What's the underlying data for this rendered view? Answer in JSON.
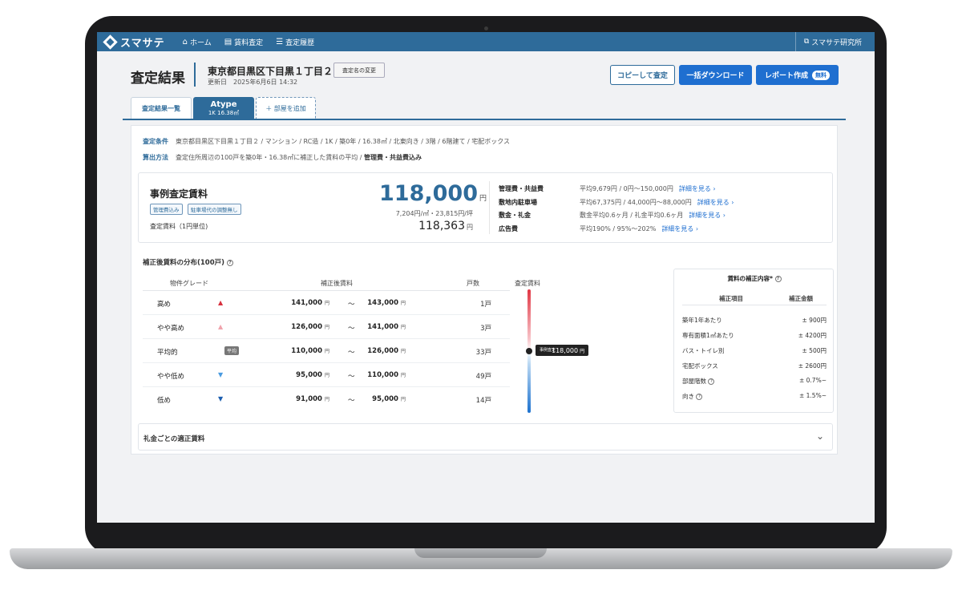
{
  "nav": {
    "logo": "スマサテ",
    "items": [
      {
        "icon": "home-icon",
        "label": "ホーム"
      },
      {
        "icon": "document-icon",
        "label": "賃料査定"
      },
      {
        "icon": "list-icon",
        "label": "査定履歴"
      }
    ],
    "right_icon": "external-link-icon",
    "right_label": "スマサテ研究所"
  },
  "header": {
    "title": "査定結果",
    "address": "東京都目黒区下目黒１丁目２",
    "updated": "更新日　2025年6月6日 14:32",
    "rename_button": "査定名の変更",
    "copy_button": "コピーして査定",
    "download_button": "一括ダウンロード",
    "report_button": "レポート作成",
    "free_badge": "無料"
  },
  "tabs": {
    "list": "査定結果一覧",
    "active_name": "Atype",
    "active_sub": "1K 16.38㎡",
    "add": "＋ 部屋を追加"
  },
  "conditions": {
    "label1": "査定条件",
    "value1": "東京都目黒区下目黒１丁目２ / マンション / RC造 / 1K / 築0年 / 16.38㎡ / 北東向き / 3階 / 6階建て / 宅配ボックス",
    "label2": "算出方法",
    "value2a": "査定住所周辺の100戸を築0年・16.38㎡に補正した賃料の平均 /",
    "value2b": "管理費・共益費込み"
  },
  "summary": {
    "title": "事例査定賃料",
    "tag1": "管理費込み",
    "tag2": "駐車場代の調整無し",
    "subtitle": "査定賃料（1円単位)",
    "price": "118,000",
    "yen": "円",
    "unit_price": "7,204円/㎡・23,815円/坪",
    "exact": "118,363",
    "fees": [
      {
        "key": "管理費・共益費",
        "value": "平均9,679円 / 0円〜150,000円",
        "link": "詳細を見る ›"
      },
      {
        "key": "敷地内駐車場",
        "value": "平均67,375円 / 44,000円〜88,000円",
        "link": "詳細を見る ›"
      },
      {
        "key": "敷金・礼金",
        "value": "敷金平均0.6ヶ月 / 礼金平均0.6ヶ月",
        "link": "詳細を見る ›"
      },
      {
        "key": "広告費",
        "value": "平均190% / 95%〜202%",
        "link": "詳細を見る ›"
      }
    ]
  },
  "distribution": {
    "title": "補正後賃料の分布(100戸)",
    "col_grade": "物件グレード",
    "col_range": "補正後賃料",
    "col_count": "戸数",
    "col_gauge": "査定賃料",
    "yen": "円",
    "tilde": "〜",
    "avg_chip": "平均",
    "rows": [
      {
        "grade": "高め",
        "mark": "▲",
        "color": "#d7303e",
        "lo": "141,000",
        "hi": "143,000",
        "count": "1戸"
      },
      {
        "grade": "やや高め",
        "mark": "▲",
        "color": "#f0a3ac",
        "lo": "126,000",
        "hi": "141,000",
        "count": "3戸"
      },
      {
        "grade": "平均的",
        "mark": "",
        "color": "#777777",
        "lo": "110,000",
        "hi": "126,000",
        "count": "33戸"
      },
      {
        "grade": "やや低め",
        "mark": "▼",
        "color": "#4a9be0",
        "lo": "95,000",
        "hi": "110,000",
        "count": "49戸"
      },
      {
        "grade": "低め",
        "mark": "▼",
        "color": "#1d5fb0",
        "lo": "91,000",
        "hi": "95,000",
        "count": "14戸"
      }
    ],
    "gauge_small": "事例査定",
    "gauge_value": "118,000",
    "gauge_yen": "円"
  },
  "correction": {
    "title": "賃料の補正内容*",
    "col_item": "補正項目",
    "col_amount": "補正金額",
    "rows": [
      {
        "item": "築年1年あたり",
        "amount": "± 900円",
        "help": false
      },
      {
        "item": "専有面積1㎡あたり",
        "amount": "± 4200円",
        "help": false
      },
      {
        "item": "バス・トイレ別",
        "amount": "± 500円",
        "help": false
      },
      {
        "item": "宅配ボックス",
        "amount": "± 2600円",
        "help": false
      },
      {
        "item": "部屋階数",
        "amount": "± 0.7%~",
        "help": true
      },
      {
        "item": "向き",
        "amount": "± 1.5%~",
        "help": true
      }
    ]
  },
  "accordion": {
    "label": "礼金ごとの適正賃料"
  }
}
